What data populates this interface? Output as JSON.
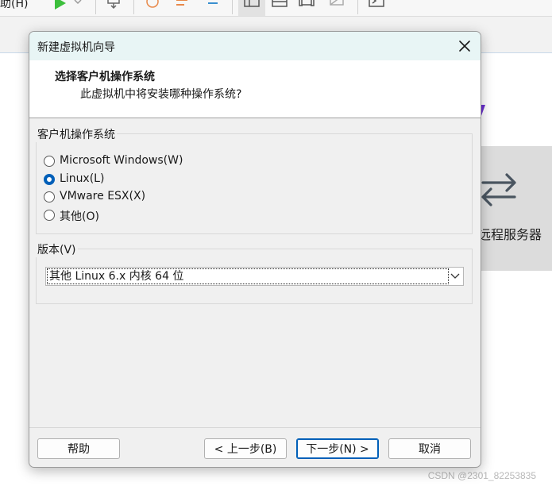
{
  "app": {
    "menu_help": "助(H)",
    "remote_label": "远程服务器"
  },
  "watermark": "CSDN @2301_82253835",
  "dialog": {
    "title": "新建虚拟机向导",
    "header_title": "选择客户机操作系统",
    "header_subtitle": "此虚拟机中将安装哪种操作系统?",
    "os_group_label": "客户机操作系统",
    "os_options": [
      {
        "label": "Microsoft Windows(W)",
        "checked": false
      },
      {
        "label": "Linux(L)",
        "checked": true
      },
      {
        "label": "VMware ESX(X)",
        "checked": false
      },
      {
        "label": "其他(O)",
        "checked": false
      }
    ],
    "version_group_label": "版本(V)",
    "version_selected": "其他 Linux 6.x 内核 64 位",
    "buttons": {
      "help": "帮助",
      "back": "< 上一步(B)",
      "next": "下一步(N) >",
      "cancel": "取消"
    }
  },
  "colors": {
    "accent": "#005fb8",
    "titlebar": "#e8f5f5",
    "play_green": "#3cbf3c",
    "brand_purple": "#6a2fd0"
  }
}
